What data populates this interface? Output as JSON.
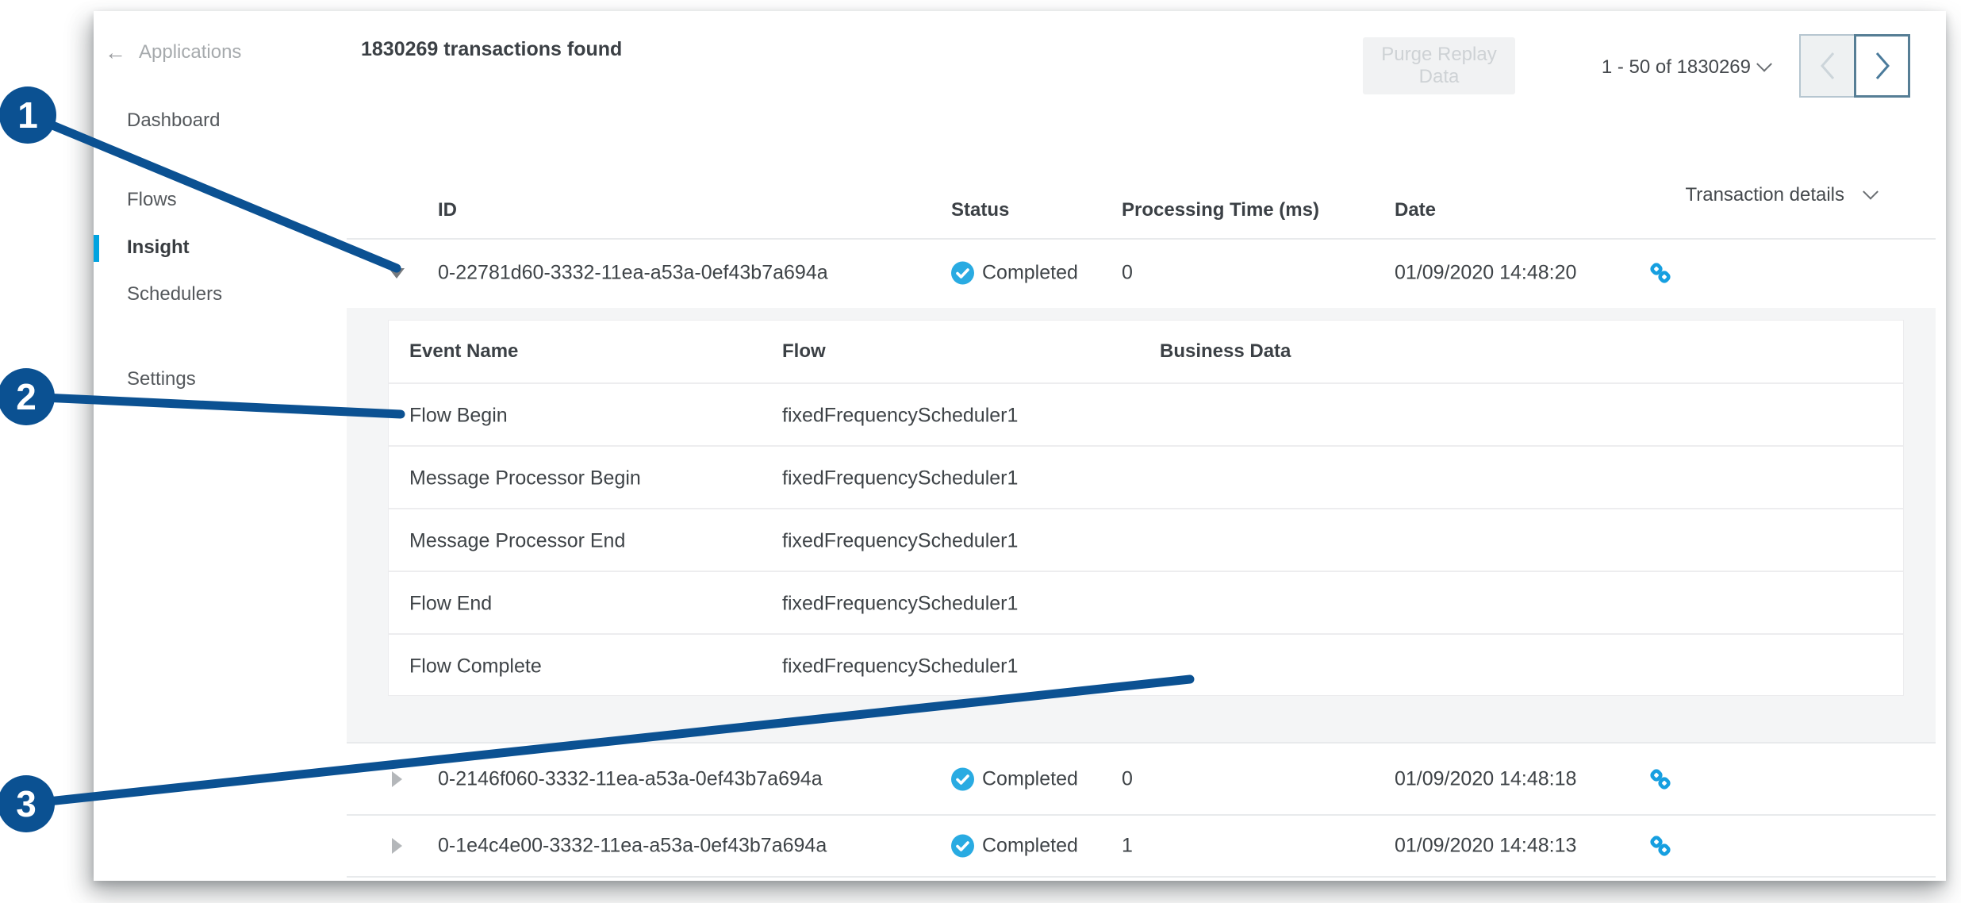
{
  "colors": {
    "callout_blue": "#0b5192",
    "nav_active_indicator": "#00a3e0",
    "status_completed_icon": "#29abe2",
    "link_icon": "#169fe0"
  },
  "sidebar": {
    "back_label": "Applications",
    "items": [
      {
        "label": "Dashboard"
      },
      {
        "label": "Flows"
      },
      {
        "label": "Insight"
      },
      {
        "label": "Schedulers"
      },
      {
        "label": "Settings"
      }
    ]
  },
  "header": {
    "title": "1830269 transactions found",
    "purge_button": "Purge Replay Data",
    "pagination_range": "1 - 50 of 1830269"
  },
  "table": {
    "columns": {
      "id": "ID",
      "status": "Status",
      "processing": "Processing Time (ms)",
      "date": "Date"
    },
    "details_dropdown": "Transaction details",
    "rows": [
      {
        "id": "0-22781d60-3332-11ea-a53a-0ef43b7a694a",
        "status": "Completed",
        "processing_time": "0",
        "date": "01/09/2020 14:48:20"
      },
      {
        "id": "0-2146f060-3332-11ea-a53a-0ef43b7a694a",
        "status": "Completed",
        "processing_time": "0",
        "date": "01/09/2020 14:48:18"
      },
      {
        "id": "0-1e4c4e00-3332-11ea-a53a-0ef43b7a694a",
        "status": "Completed",
        "processing_time": "1",
        "date": "01/09/2020 14:48:13"
      }
    ]
  },
  "events_table": {
    "columns": {
      "event_name": "Event Name",
      "flow": "Flow",
      "business_data": "Business Data"
    },
    "rows": [
      {
        "name": "Flow Begin",
        "flow": "fixedFrequencyScheduler1",
        "business_data": ""
      },
      {
        "name": "Message Processor Begin",
        "flow": "fixedFrequencyScheduler1",
        "business_data": ""
      },
      {
        "name": "Message Processor End",
        "flow": "fixedFrequencyScheduler1",
        "business_data": ""
      },
      {
        "name": "Flow End",
        "flow": "fixedFrequencyScheduler1",
        "business_data": ""
      },
      {
        "name": "Flow Complete",
        "flow": "fixedFrequencyScheduler1",
        "business_data": ""
      }
    ]
  },
  "callouts": [
    {
      "label": "1"
    },
    {
      "label": "2"
    },
    {
      "label": "3"
    }
  ]
}
